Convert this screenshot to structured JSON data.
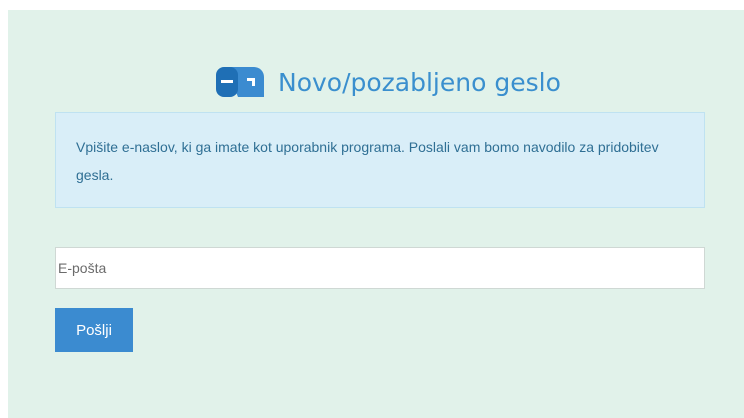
{
  "header": {
    "title": "Novo/pozabljeno geslo",
    "icon": "mailbox-icon"
  },
  "info": {
    "text": "Vpišite e-naslov, ki ga imate kot uporabnik programa. Poslali vam bomo navodilo za pridobitev gesla."
  },
  "form": {
    "email_placeholder": "E-pošta",
    "email_value": "",
    "submit_label": "Pošlji"
  },
  "colors": {
    "background": "#e1f2ea",
    "accent": "#3b8bd0",
    "info_background": "#d9eef8",
    "info_text": "#2f6f94"
  }
}
